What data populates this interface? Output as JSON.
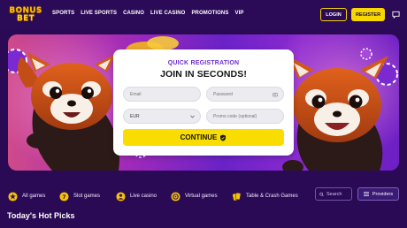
{
  "brand": {
    "logo_line1": "BONUS",
    "logo_line2": "BET",
    "accent": "#f7d700",
    "background": "#2a0a55"
  },
  "nav": {
    "items": [
      "SPORTS",
      "LIVE SPORTS",
      "CASINO",
      "LIVE CASINO",
      "PROMOTIONS",
      "VIP"
    ]
  },
  "header": {
    "login_label": "LOGIN",
    "register_label": "REGISTER",
    "chat_icon": "chat-bubble-icon"
  },
  "registration": {
    "subtitle": "QUICK REGISTRATION",
    "title": "JOIN IN SECONDS!",
    "email_placeholder": "Email",
    "password_placeholder": "Password",
    "currency_value": "EUR",
    "promo_placeholder": "Promo code (optional)",
    "continue_label": "CONTINUE",
    "subtitle_color": "#6b2fd0"
  },
  "categories": {
    "items": [
      {
        "label": "All games",
        "icon": "star-icon"
      },
      {
        "label": "Slot games",
        "icon": "slot-icon"
      },
      {
        "label": "Live casino",
        "icon": "dealer-icon"
      },
      {
        "label": "Virtual games",
        "icon": "virtual-icon"
      },
      {
        "label": "Table & Crash Games",
        "icon": "cards-icon"
      }
    ],
    "search_placeholder": "Search",
    "providers_label": "Providers"
  },
  "section": {
    "title": "Today's Hot Picks"
  }
}
